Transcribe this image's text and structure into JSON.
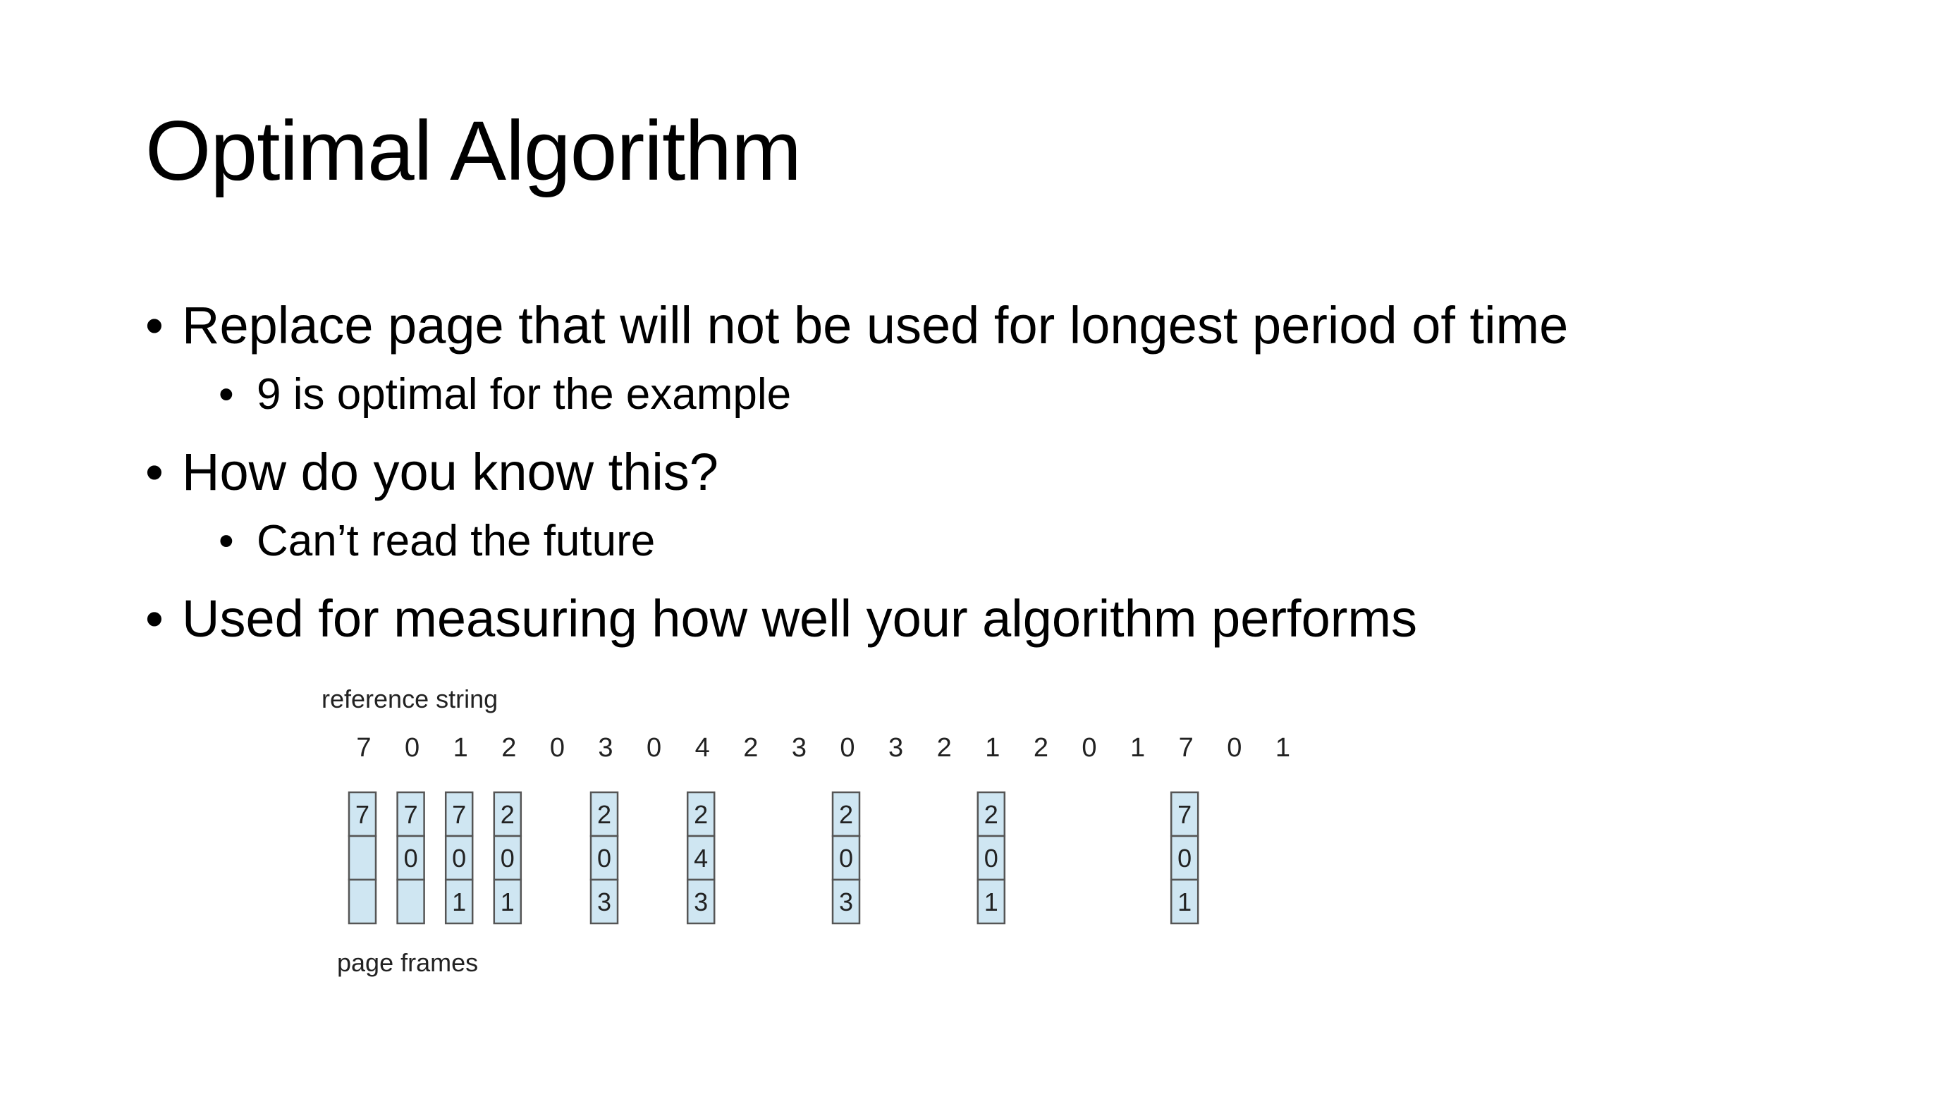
{
  "slide": {
    "title": "Optimal Algorithm",
    "bullets": [
      {
        "level": 1,
        "text": "Replace page that will not be used for longest period of time"
      },
      {
        "level": 2,
        "text": "9 is optimal for the example"
      },
      {
        "level": 1,
        "text": "How do you know this?"
      },
      {
        "level": 2,
        "text": "Can’t read the future"
      },
      {
        "level": 1,
        "text": "Used for measuring how well your algorithm performs"
      }
    ],
    "bullet_glyph": "•"
  },
  "figure": {
    "reference_label": "reference string",
    "frames_label": "page frames",
    "reference_string": [
      "7",
      "0",
      "1",
      "2",
      "0",
      "3",
      "0",
      "4",
      "2",
      "3",
      "0",
      "3",
      "2",
      "1",
      "2",
      "0",
      "1",
      "7",
      "0",
      "1"
    ],
    "frame_states": [
      {
        "ref_index": 0,
        "frames": [
          "7",
          "",
          ""
        ]
      },
      {
        "ref_index": 1,
        "frames": [
          "7",
          "0",
          ""
        ]
      },
      {
        "ref_index": 2,
        "frames": [
          "7",
          "0",
          "1"
        ]
      },
      {
        "ref_index": 3,
        "frames": [
          "2",
          "0",
          "1"
        ]
      },
      {
        "ref_index": 5,
        "frames": [
          "2",
          "0",
          "3"
        ]
      },
      {
        "ref_index": 7,
        "frames": [
          "2",
          "4",
          "3"
        ]
      },
      {
        "ref_index": 10,
        "frames": [
          "2",
          "0",
          "3"
        ]
      },
      {
        "ref_index": 13,
        "frames": [
          "2",
          "0",
          "1"
        ]
      },
      {
        "ref_index": 17,
        "frames": [
          "7",
          "0",
          "1"
        ]
      }
    ],
    "colors": {
      "frame_fill": "#cfe6f2",
      "frame_stroke": "#555555",
      "text": "#222222"
    }
  }
}
